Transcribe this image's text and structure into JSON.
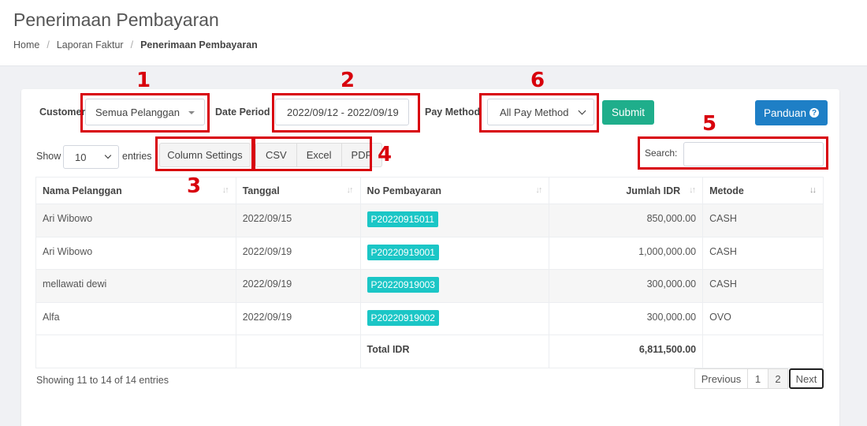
{
  "header": {
    "title": "Penerimaan Pembayaran",
    "breadcrumb": [
      "Home",
      "Laporan Faktur",
      "Penerimaan Pembayaran"
    ]
  },
  "filters": {
    "customer_label": "Customer",
    "customer_value": "Semua Pelanggan",
    "date_label": "Date Period",
    "date_value": "2022/09/12 - 2022/09/19",
    "pay_label": "Pay Method",
    "pay_value": "All Pay Method",
    "submit_label": "Submit",
    "guide_label": "Panduan"
  },
  "table_controls": {
    "show_label": "Show",
    "entries_value": "10",
    "entries_label": "entries",
    "column_settings_label": "Column Settings",
    "export_buttons": [
      "CSV",
      "Excel",
      "PDF"
    ],
    "search_label": "Search:",
    "search_value": ""
  },
  "table": {
    "columns": [
      "Nama Pelanggan",
      "Tanggal",
      "No Pembayaran",
      "Jumlah IDR",
      "Metode"
    ],
    "rows": [
      {
        "name": "Ari Wibowo",
        "date": "2022/09/15",
        "number": "P20220915011",
        "amount": "850,000.00",
        "method": "CASH"
      },
      {
        "name": "Ari Wibowo",
        "date": "2022/09/19",
        "number": "P20220919001",
        "amount": "1,000,000.00",
        "method": "CASH"
      },
      {
        "name": "mellawati dewi",
        "date": "2022/09/19",
        "number": "P20220919003",
        "amount": "300,000.00",
        "method": "CASH"
      },
      {
        "name": "Alfa",
        "date": "2022/09/19",
        "number": "P20220919002",
        "amount": "300,000.00",
        "method": "OVO"
      }
    ],
    "total_label": "Total IDR",
    "total_value": "6,811,500.00"
  },
  "footer": {
    "info": "Showing 11 to 14 of 14 entries",
    "pagination": {
      "previous": "Previous",
      "pages": [
        "1",
        "2"
      ],
      "next": "Next"
    }
  },
  "annotations": [
    "1",
    "2",
    "3",
    "4",
    "5",
    "6"
  ],
  "colors": {
    "submit": "#1fae8b",
    "guide": "#1e7fc6",
    "badge": "#1bc6c6",
    "annotation": "#d8000c"
  }
}
